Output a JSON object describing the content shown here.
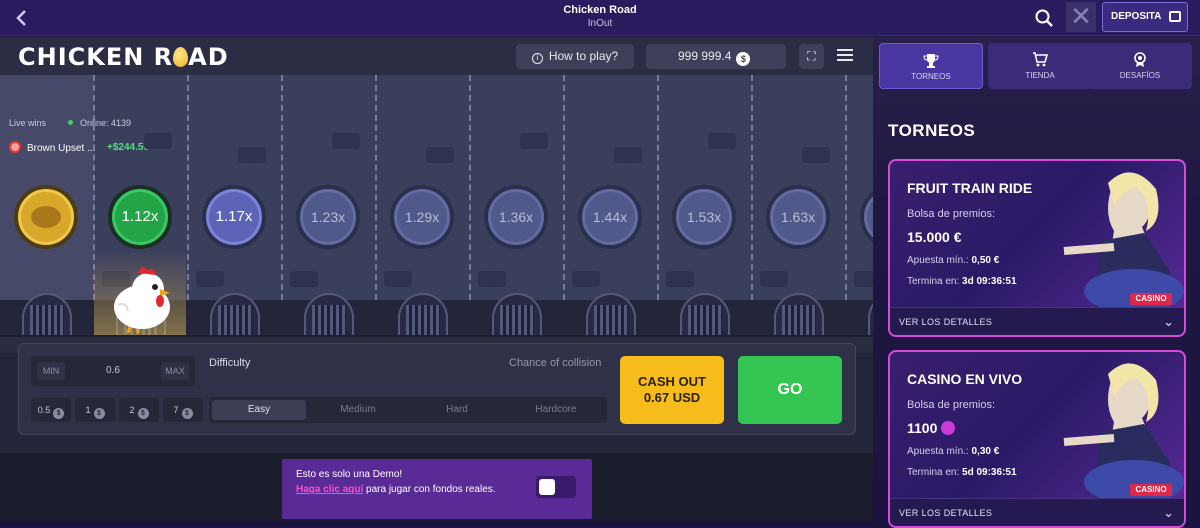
{
  "topbar": {
    "title": "Chicken Road",
    "subtitle": "InOut",
    "deposit_label": "DEPOSITA"
  },
  "game": {
    "logo_pre": "CHICKEN R",
    "logo_post": "AD",
    "how_to_play": "How to play?",
    "balance": "999 999.4",
    "currency_symbol": "$",
    "live_wins": "Live wins",
    "online": "Online: 4139",
    "winner_name": "Brown Upset ...",
    "winner_amount": "+$244.50",
    "multipliers": [
      "1.12x",
      "1.17x",
      "1.23x",
      "1.29x",
      "1.36x",
      "1.44x",
      "1.53x",
      "1.63x"
    ],
    "bet": {
      "min": "MIN",
      "value": "0.6",
      "max": "MAX"
    },
    "chips": [
      "0.5",
      "1",
      "2",
      "7"
    ],
    "difficulty_label": "Difficulty",
    "collision_label": "Chance of collision",
    "difficulties": [
      "Easy",
      "Medium",
      "Hard",
      "Hardcore"
    ],
    "selected_difficulty": "Easy",
    "cashout_line1": "CASH OUT",
    "cashout_line2": "0.67 USD",
    "go_label": "GO",
    "demo_line1": "Esto es solo una Demo!",
    "demo_link": "Haga clic aquí",
    "demo_rest": " para jugar con fondos reales.",
    "demo_toggle_on": false
  },
  "side": {
    "tabs": [
      "TORNEOS",
      "TIENDA",
      "DESAFÍOS"
    ],
    "active_tab": "TORNEOS",
    "title": "TORNEOS",
    "cards": [
      {
        "title": "FRUIT TRAIN RIDE",
        "pool_label": "Bolsa de premios:",
        "pool": "15.000 €",
        "min_label": "Apuesta mín.:",
        "min_value": "0,50 €",
        "end_label": "Termina en:",
        "end_value": "3d 09:36:51",
        "tag": "CASINO",
        "details": "VER LOS DETALLES"
      },
      {
        "title": "CASINO EN VIVO",
        "pool_label": "Bolsa de premios:",
        "pool": "1100",
        "min_label": "Apuesta mín.:",
        "min_value": "0,30 €",
        "end_label": "Termina en:",
        "end_value": "5d 09:36:51",
        "tag": "CASINO",
        "details": "VER LOS DETALLES"
      }
    ]
  },
  "colors": {
    "accent": "#34c553",
    "cashout": "#f5bc1c",
    "brand_purple": "#2a1a5e",
    "card_border": "#d84bd8"
  }
}
